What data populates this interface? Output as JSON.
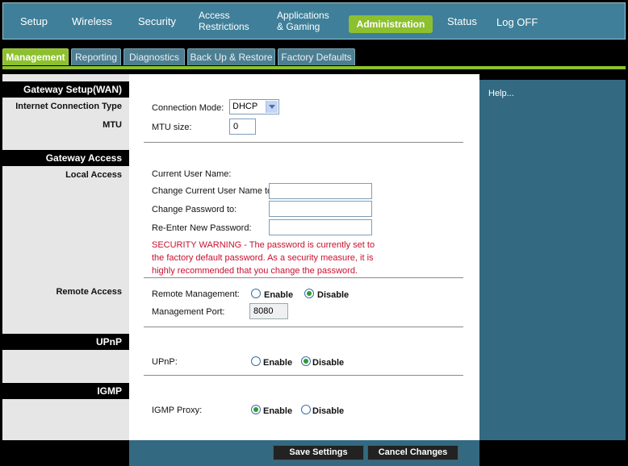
{
  "nav": {
    "setup": "Setup",
    "wireless": "Wireless",
    "security": "Security",
    "access_1": "Access",
    "access_2": "Restrictions",
    "apps_1": "Applications",
    "apps_2": "& Gaming",
    "administration": "Administration",
    "status": "Status",
    "logoff": "Log OFF"
  },
  "subtabs": [
    "Management",
    "Reporting",
    "Diagnostics",
    "Back Up & Restore",
    "Factory Defaults"
  ],
  "sections": {
    "gateway_setup": "Gateway Setup(WAN)",
    "internet_connection_type": "Internet Connection Type",
    "mtu": "MTU",
    "gateway_access": "Gateway Access",
    "local_access": "Local Access",
    "remote_access": "Remote Access",
    "upnp": "UPnP",
    "igmp": "IGMP"
  },
  "form": {
    "connection_mode_label": "Connection Mode:",
    "connection_mode_value": "DHCP",
    "mtu_size_label": "MTU size:",
    "mtu_size_value": "0",
    "current_user_label": "Current User Name:",
    "change_user_label": "Change Current User Name to:",
    "change_password_label": "Change Password to:",
    "reenter_password_label": "Re-Enter New Password:",
    "warning_1": "SECURITY WARNING - The password is currently set to",
    "warning_2": "the factory default password. As a security measure, it is",
    "warning_3": "highly recommended that you change the password.",
    "remote_mgmt_label": "Remote Management:",
    "mgmt_port_label": "Management Port:",
    "mgmt_port_value": "8080",
    "upnp_label": "UPnP:",
    "igmp_label": "IGMP Proxy:",
    "enable": "Enable",
    "disable": "Disable"
  },
  "help": "Help...",
  "buttons": {
    "save": "Save Settings",
    "cancel": "Cancel Changes"
  },
  "radio_state": {
    "remote_management": "Disable",
    "upnp": "Disable",
    "igmp_proxy": "Enable"
  },
  "colors": {
    "nav_bg": "#3f7f99",
    "accent_green": "#8dc02e",
    "help_bg": "#336a82",
    "warning_red": "#c8102e"
  }
}
